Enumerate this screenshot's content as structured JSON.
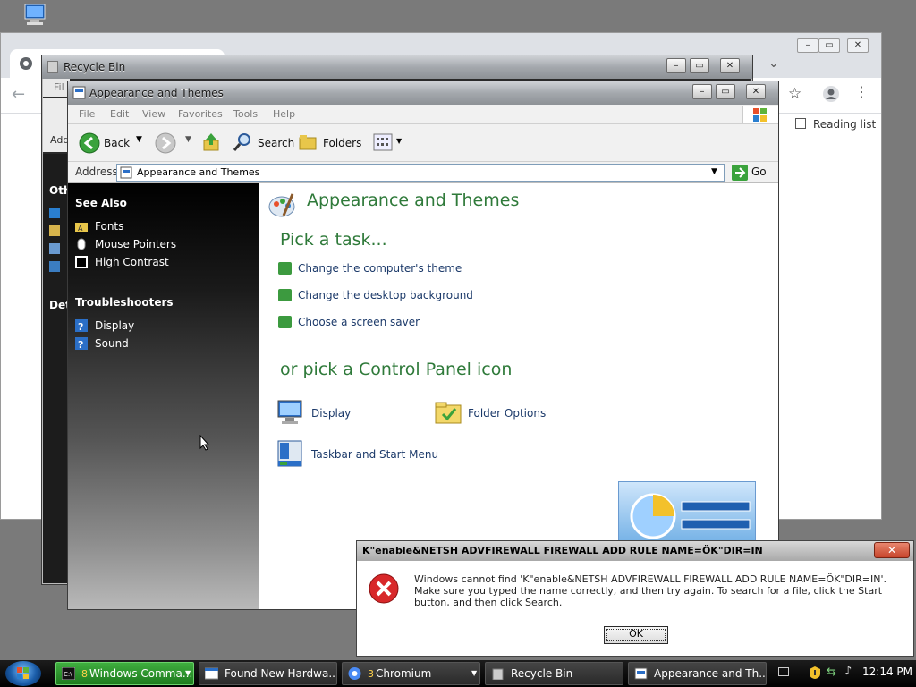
{
  "chromium": {
    "reading_list": "Reading list"
  },
  "recycle_bin": {
    "title": "Recycle Bin",
    "menu_partial": "Fil",
    "address_partial": "Add",
    "side_other": "Oth",
    "side_details": "Det"
  },
  "appearance": {
    "title": "Appearance and Themes",
    "menu": [
      "File",
      "Edit",
      "View",
      "Favorites",
      "Tools",
      "Help"
    ],
    "toolbar": {
      "back": "Back",
      "search": "Search",
      "folders": "Folders"
    },
    "address": {
      "label": "Address",
      "value": "Appearance and Themes",
      "go": "Go"
    },
    "sidebar": {
      "see_also": {
        "heading": "See Also",
        "items": [
          "Fonts",
          "Mouse Pointers",
          "High Contrast"
        ]
      },
      "troubleshooters": {
        "heading": "Troubleshooters",
        "items": [
          "Display",
          "Sound"
        ]
      }
    },
    "content": {
      "heading": "Appearance and Themes",
      "pick_task": "Pick a task...",
      "tasks": [
        "Change the computer's theme",
        "Change the desktop background",
        "Choose a screen saver"
      ],
      "pick_icon": "or pick a Control Panel icon",
      "icons": [
        "Display",
        "Folder Options",
        "Taskbar and Start Menu"
      ]
    }
  },
  "error_dialog": {
    "title": "K\"enable&NETSH ADVFIREWALL FIREWALL ADD RULE NAME=ÖK\"DIR=IN",
    "message": "Windows cannot find 'K\"enable&NETSH ADVFIREWALL FIREWALL ADD RULE NAME=ÖK\"DIR=IN'. Make sure you typed the name correctly, and then try again. To search for a file, click the Start button, and then click Search.",
    "ok": "OK",
    "close": "✕"
  },
  "taskbar": {
    "items": [
      {
        "badge": "8",
        "label": "Windows Comma..."
      },
      {
        "label": "Found New Hardwa..."
      },
      {
        "badge": "3",
        "label": "Chromium"
      },
      {
        "label": "Recycle Bin"
      },
      {
        "label": "Appearance and Th..."
      }
    ],
    "clock": "12:14 PM"
  },
  "colors": {
    "accent_green": "#2f7a3a",
    "link_blue": "#1c3a6a",
    "error_red": "#c7452b"
  }
}
